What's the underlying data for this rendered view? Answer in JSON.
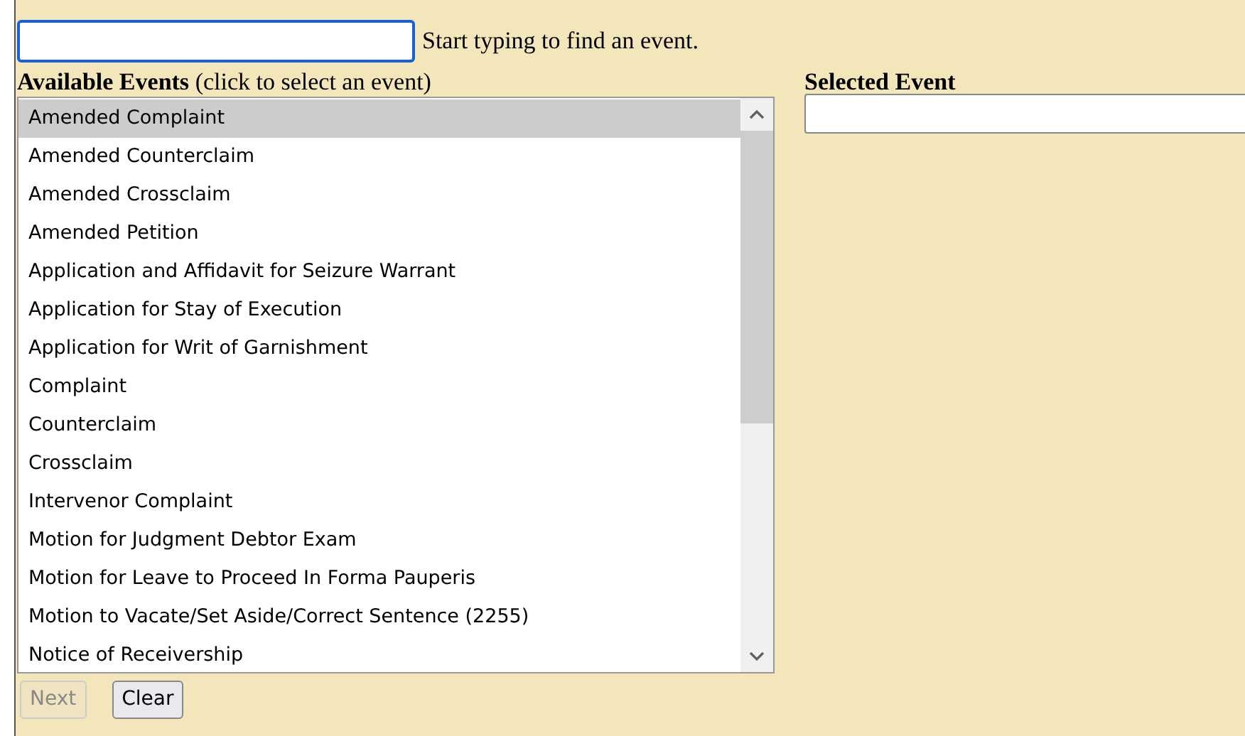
{
  "search": {
    "hint": "Start typing to find an event.",
    "focused": true
  },
  "available_events": {
    "title": "Available Events",
    "subtitle": "(click to select an event)",
    "items": [
      {
        "label": "Amended Complaint",
        "selected": true
      },
      {
        "label": "Amended Counterclaim",
        "selected": false
      },
      {
        "label": "Amended Crossclaim",
        "selected": false
      },
      {
        "label": "Amended Petition",
        "selected": false
      },
      {
        "label": "Application and Affidavit for Seizure Warrant",
        "selected": false
      },
      {
        "label": "Application for Stay of Execution",
        "selected": false
      },
      {
        "label": "Application for Writ of Garnishment",
        "selected": false
      },
      {
        "label": "Complaint",
        "selected": false
      },
      {
        "label": "Counterclaim",
        "selected": false
      },
      {
        "label": "Crossclaim",
        "selected": false
      },
      {
        "label": "Intervenor Complaint",
        "selected": false
      },
      {
        "label": "Motion for Judgment Debtor Exam",
        "selected": false
      },
      {
        "label": "Motion for Leave to Proceed In Forma Pauperis",
        "selected": false
      },
      {
        "label": "Motion to Vacate/Set Aside/Correct Sentence (2255)",
        "selected": false
      },
      {
        "label": "Notice of Receivership",
        "selected": false
      }
    ]
  },
  "selected_event": {
    "title": "Selected Event"
  },
  "buttons": [
    {
      "label": "Next",
      "disabled": true
    },
    {
      "label": "Clear",
      "disabled": false
    }
  ]
}
